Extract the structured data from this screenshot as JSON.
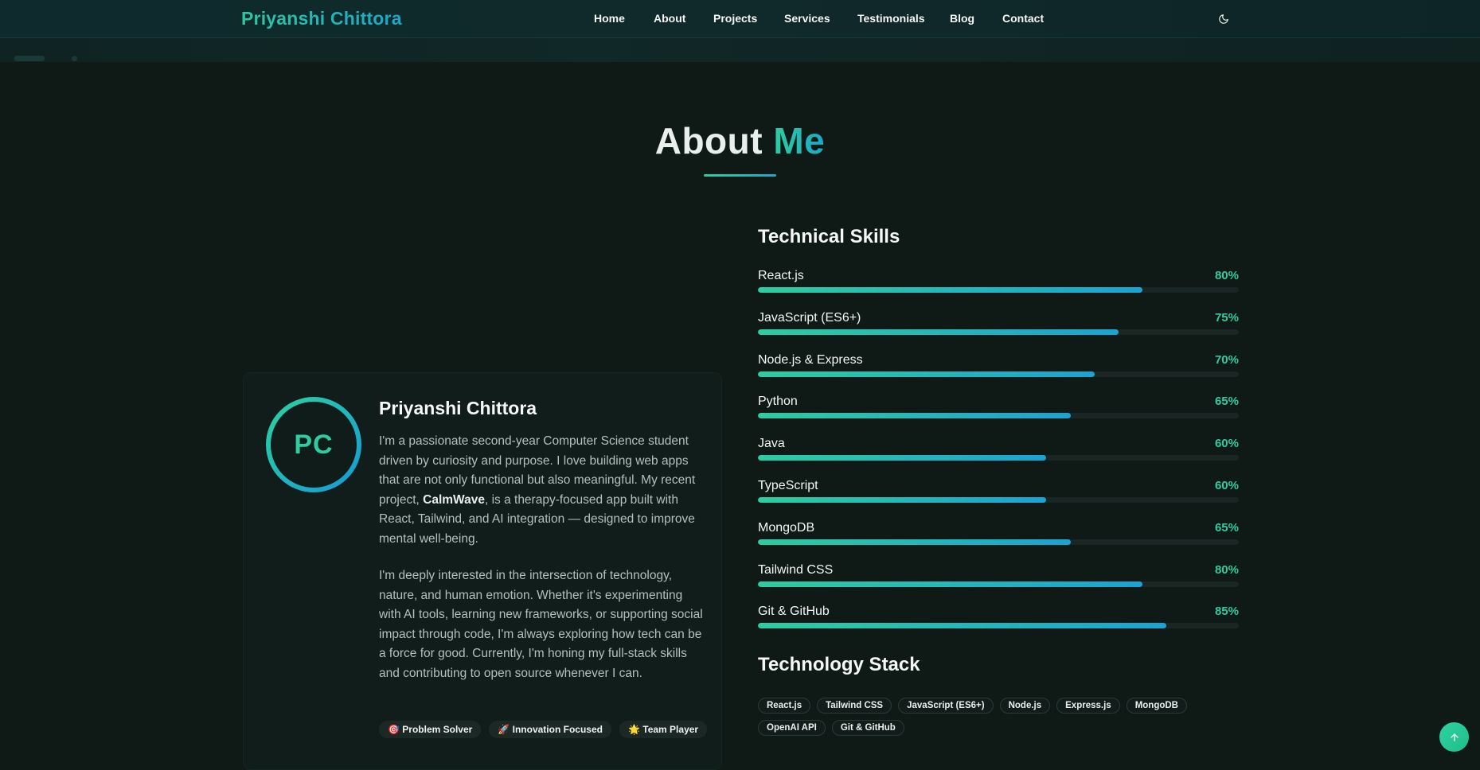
{
  "nav": {
    "brand": "Priyanshi Chittora",
    "links": [
      "Home",
      "About",
      "Projects",
      "Services",
      "Testimonials",
      "Blog",
      "Contact"
    ],
    "theme_toggle_icon": "moon-icon"
  },
  "about": {
    "title_main": "About",
    "title_accent": "Me"
  },
  "profile": {
    "initials": "PC",
    "name": "Priyanshi Chittora",
    "bio1_pre": "I'm a passionate second-year Computer Science student driven by curiosity and purpose. I love building web apps that are not only functional but also meaningful. My recent project, ",
    "bio1_bold": "CalmWave",
    "bio1_post": ", is a therapy-focused app built with React, Tailwind, and AI integration — designed to improve mental well-being.",
    "bio2": "I'm deeply interested in the intersection of technology, nature, and human emotion. Whether it's experimenting with AI tools, learning new frameworks, or supporting social impact through code, I'm always exploring how tech can be a force for good. Currently, I'm honing my full-stack skills and contributing to open source whenever I can.",
    "traits": [
      {
        "emoji": "🎯",
        "label": "Problem Solver"
      },
      {
        "emoji": "🚀",
        "label": "Innovation Focused"
      },
      {
        "emoji": "🌟",
        "label": "Team Player"
      }
    ]
  },
  "skills": {
    "heading": "Technical Skills",
    "items": [
      {
        "name": "React.js",
        "percent_label": "80%",
        "level": 80
      },
      {
        "name": "JavaScript (ES6+)",
        "percent_label": "75%",
        "level": 75
      },
      {
        "name": "Node.js & Express",
        "percent_label": "70%",
        "level": 70
      },
      {
        "name": "Python",
        "percent_label": "65%",
        "level": 65
      },
      {
        "name": "Java",
        "percent_label": "60%",
        "level": 60
      },
      {
        "name": "TypeScript",
        "percent_label": "60%",
        "level": 60
      },
      {
        "name": "MongoDB",
        "percent_label": "65%",
        "level": 65
      },
      {
        "name": "Tailwind CSS",
        "percent_label": "80%",
        "level": 80
      },
      {
        "name": "Git & GitHub",
        "percent_label": "85%",
        "level": 85
      }
    ]
  },
  "stack": {
    "heading": "Technology Stack",
    "tags": [
      "React.js",
      "Tailwind CSS",
      "JavaScript (ES6+)",
      "Node.js",
      "Express.js",
      "MongoDB",
      "OpenAI API",
      "Git & GitHub"
    ]
  },
  "colors": {
    "accent_green": "#2ecc9f",
    "accent_blue": "#1ba8c8",
    "background": "#0f1a17"
  },
  "scroll_top_icon": "arrow-up-icon"
}
